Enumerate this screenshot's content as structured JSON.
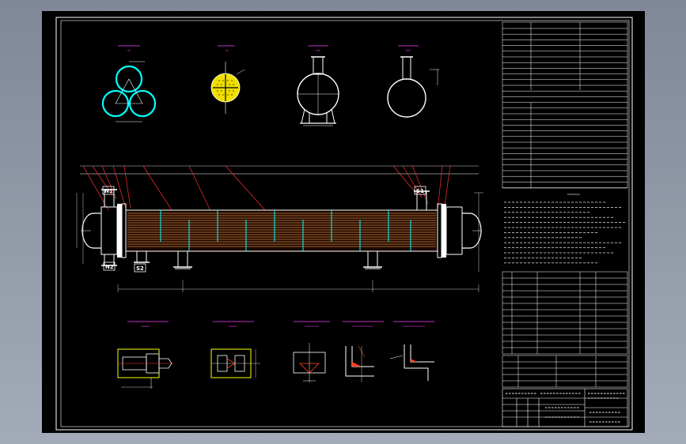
{
  "viewer": {
    "background_color": "#8a93a3",
    "sheet_color": "#000000",
    "line_colors": {
      "border": "#ffffff",
      "hatch": "#ff4020",
      "cyan": "#00ffff",
      "yellow": "#ffff00",
      "magenta": "#ff40ff",
      "red_leader": "#ff3030",
      "tubes": "#e08040"
    }
  },
  "drawing": {
    "nozzle_tags": [
      "N1",
      "N2",
      "S1",
      "S2"
    ],
    "icons": [
      "tube-layout-icon",
      "tube-sheet-icon",
      "head-section-icon",
      "shell-section-icon"
    ]
  }
}
